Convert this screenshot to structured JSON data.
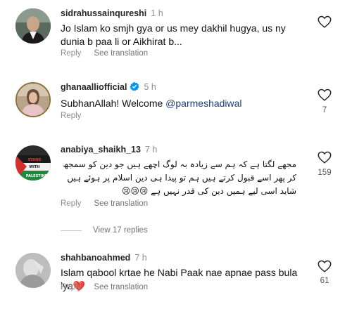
{
  "comments": [
    {
      "username": "sidrahussainqureshi",
      "time": "1 h",
      "text": "Jo Islam ko smjh gya or us mey dakhil hugya, us ny dunia b paa li or Aikhirat b...",
      "reply": "Reply",
      "see_translation": "See translation",
      "likes": ""
    },
    {
      "username": "ghanaalliofficial",
      "time": "5 h",
      "text_prefix": "SubhanAllah! Welcome ",
      "mention": "@parmeshadiwal",
      "reply": "Reply",
      "likes": "7"
    },
    {
      "username": "anabiya_shaikh_13",
      "time": "7 h",
      "text": "مجھے لگتا ہے کہ ہم سے زیادہ بہ لوگ اچھے ہیں جو دین کو سمجھ کر پھر اسے قبول کرتے ہیں ہم تو پیدا ہی دین اسلام پر ہوئے ہیں شاید اسی لیے ہمیں دین کی قدر نہیں ہے 😢😢😢",
      "reply": "Reply",
      "see_translation": "See translation",
      "likes": "159",
      "avatar_text": "STAND WITH PALESTINE"
    },
    {
      "username": "shahbanoahmed",
      "time": "7 h",
      "text": "Islam qabool krtae he Nabi Paak nae apnae pass bula lya❤️",
      "reply": "Reply",
      "see_translation": "See translation",
      "likes": "61"
    }
  ],
  "view_replies": "View 17 replies",
  "colors": {
    "heart_outline": "#262626",
    "meta": "#8e8e8e",
    "verified": "#0095f6"
  }
}
